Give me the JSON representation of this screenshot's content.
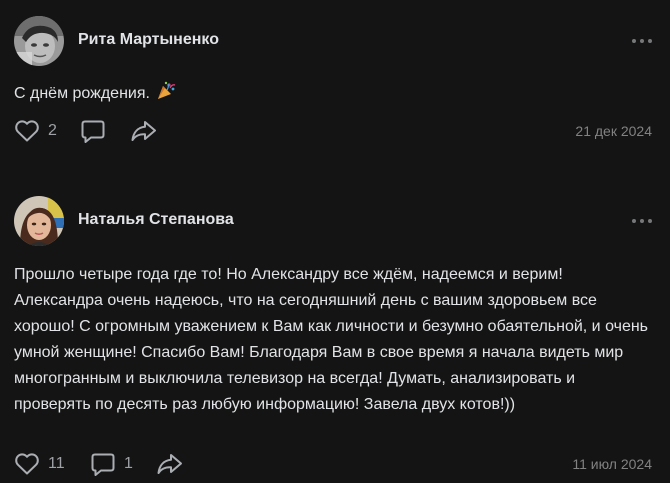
{
  "posts": [
    {
      "author": "Рита Мартыненко",
      "text": "С днём рождения.",
      "emoji": "party-popper-icon",
      "likes": "2",
      "comments": "",
      "date": "21 дек 2024"
    },
    {
      "author": "Наталья Степанова",
      "text": "Прошло четыре года где то! Но Александру все ждём, надеемся и верим! Александра очень надеюсь, что на сегодняшний день с вашим здоровьем все хорошо! С огромным уважением к Вам как личности и безумно обаятельной, и очень умной женщине! Спасибо Вам! Благодаря Вам в свое время я начала видеть мир многогранным и выключила телевизор на всегда! Думать, анализировать и проверять по десять раз любую информацию! Завела двух котов!))",
      "likes": "11",
      "comments": "1",
      "date": "11 июл 2024"
    }
  ],
  "colors": {
    "background": "#141414",
    "text": "#e1e3e6",
    "secondary": "#828282",
    "icon": "#aaaeb3"
  }
}
